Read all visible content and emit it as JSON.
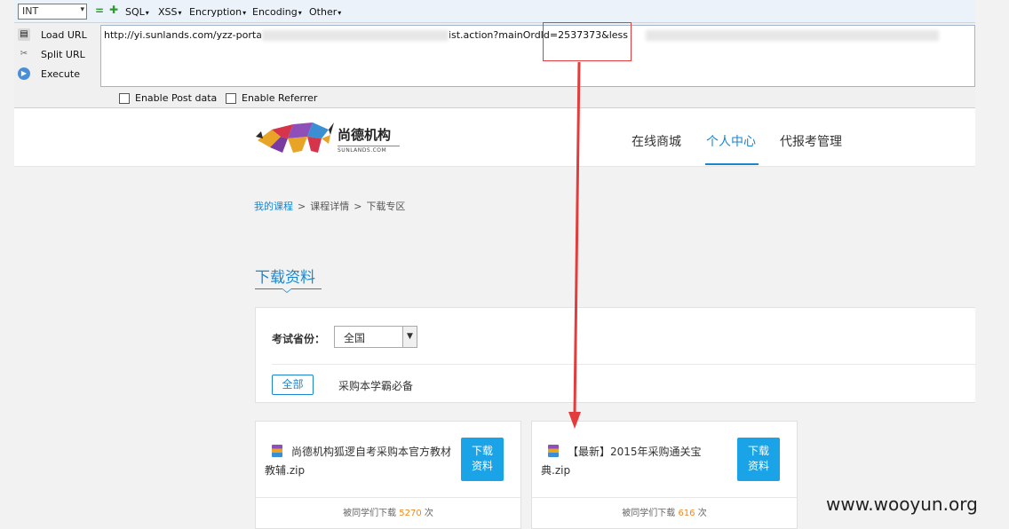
{
  "hackbar": {
    "int_value": "INT",
    "menus": [
      "SQL",
      "XSS",
      "Encryption",
      "Encoding",
      "Other"
    ],
    "buttons": {
      "load": "Load URL",
      "split": "Split URL",
      "execute": "Execute"
    },
    "url_start": "http://yi.sunlands.com/yzz-porta",
    "url_mid": "ist.action?mainOrdId=2537373&less",
    "checkboxes": {
      "post": "Enable Post data",
      "referrer": "Enable Referrer"
    }
  },
  "site": {
    "logo_text": "尚德机构",
    "logo_sub": "SUNLANDS.COM",
    "nav": [
      "在线商城",
      "个人中心",
      "代报考管理"
    ]
  },
  "breadcrumb": {
    "link": "我的课程",
    "sep": ">",
    "middle": "课程详情",
    "current": "下载专区"
  },
  "section_title": "下载资料",
  "filter": {
    "label": "考试省份：",
    "province_selected": "全国",
    "tag_all": "全部",
    "tag_category": "采购本学霸必备"
  },
  "cards": [
    {
      "title": "尚德机构狐逻自考采购本官方教材教辅.zip",
      "button": "下载\n资料",
      "foot_prefix": "被同学们下载",
      "count": "5270",
      "foot_suffix": "次"
    },
    {
      "title": "【最新】2015年采购通关宝典.zip",
      "button": "下载\n资料",
      "foot_prefix": "被同学们下载",
      "count": "616",
      "foot_suffix": "次"
    }
  ],
  "watermark": "www.wooyun.org",
  "colors": {
    "accent": "#1a86d0",
    "button": "#1aa3e6",
    "count": "#f08a24",
    "annotation": "#e43c3c"
  }
}
